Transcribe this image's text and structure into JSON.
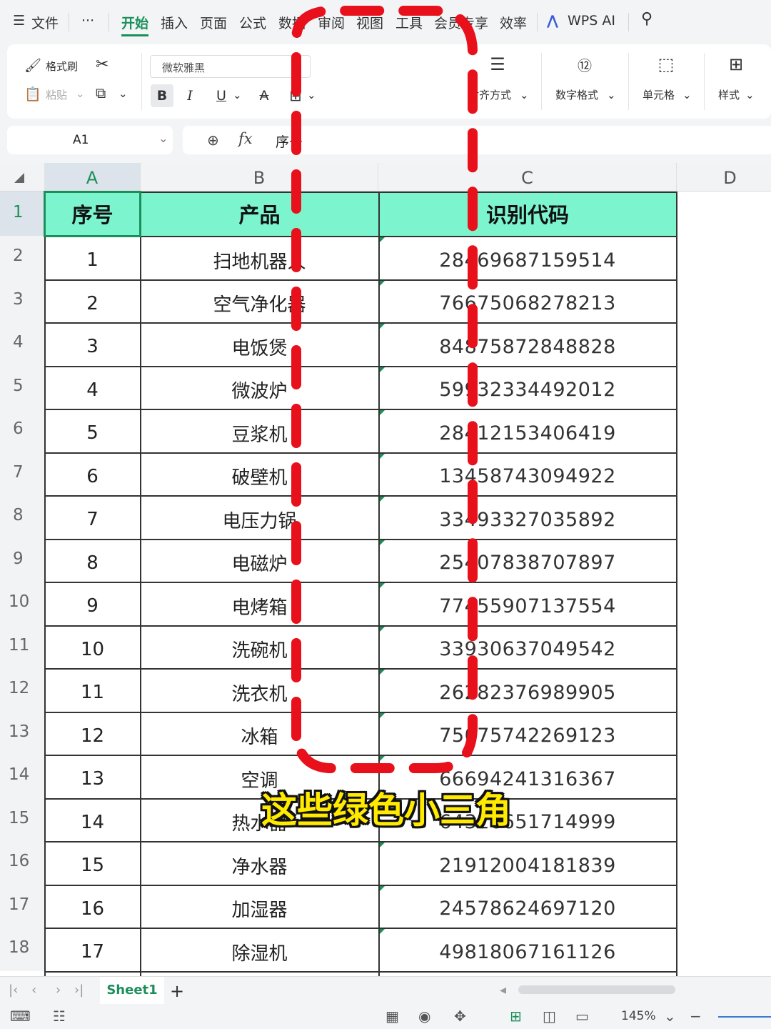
{
  "menu": {
    "file_label": "文件",
    "more_label": "···",
    "tabs": [
      "开始",
      "插入",
      "页面",
      "公式",
      "数据",
      "审阅",
      "视图",
      "工具",
      "会员专享",
      "效率"
    ],
    "active_tab": "开始",
    "ai_label": "WPS AI"
  },
  "ribbon": {
    "format_painter": "格式刷",
    "paste": "粘贴",
    "font_name": "微软雅黑",
    "bold": "B",
    "italic": "I",
    "underline": "U",
    "strike": "A",
    "align_label": "对齐方式",
    "number_format_label": "数字格式",
    "cell_label": "单元格",
    "style_label": "样式"
  },
  "formula_bar": {
    "name_box": "A1",
    "fx": "fx",
    "value": "序号"
  },
  "sheet": {
    "columns": [
      "A",
      "B",
      "C",
      "D"
    ],
    "selected_column": "A",
    "row_numbers": [
      "1",
      "2",
      "3",
      "4",
      "5",
      "6",
      "7",
      "8",
      "9",
      "10",
      "11",
      "12",
      "13",
      "14",
      "15",
      "16",
      "17",
      "18"
    ],
    "header": {
      "seq": "序号",
      "product": "产品",
      "code": "识别代码"
    },
    "rows": [
      {
        "seq": "1",
        "product": "扫地机器人",
        "code": "28469687159514"
      },
      {
        "seq": "2",
        "product": "空气净化器",
        "code": "76675068278213"
      },
      {
        "seq": "3",
        "product": "电饭煲",
        "code": "84875872848828"
      },
      {
        "seq": "4",
        "product": "微波炉",
        "code": "59932334492012"
      },
      {
        "seq": "5",
        "product": "豆浆机",
        "code": "28412153406419"
      },
      {
        "seq": "6",
        "product": "破壁机",
        "code": "13458743094922"
      },
      {
        "seq": "7",
        "product": "电压力锅",
        "code": "33493327035892"
      },
      {
        "seq": "8",
        "product": "电磁炉",
        "code": "25407838707897"
      },
      {
        "seq": "9",
        "product": "电烤箱",
        "code": "77455907137554"
      },
      {
        "seq": "10",
        "product": "洗碗机",
        "code": "33930637049542"
      },
      {
        "seq": "11",
        "product": "洗衣机",
        "code": "26282376989905"
      },
      {
        "seq": "12",
        "product": "冰箱",
        "code": "75075742269123"
      },
      {
        "seq": "13",
        "product": "空调",
        "code": "66694241316367"
      },
      {
        "seq": "14",
        "product": "热水器",
        "code": "64326651714999"
      },
      {
        "seq": "15",
        "product": "净水器",
        "code": "21912004181839"
      },
      {
        "seq": "16",
        "product": "加湿器",
        "code": "24578624697120"
      },
      {
        "seq": "17",
        "product": "除湿机",
        "code": "49818067161126"
      }
    ]
  },
  "sheet_tabs": {
    "active": "Sheet1",
    "add": "+"
  },
  "status": {
    "zoom": "145%"
  },
  "caption": "这些绿色小三角",
  "colors": {
    "header_fill": "#7cf5cf",
    "accent": "#1b8f5a",
    "dash": "#e8101a",
    "caption": "#ffea00"
  }
}
